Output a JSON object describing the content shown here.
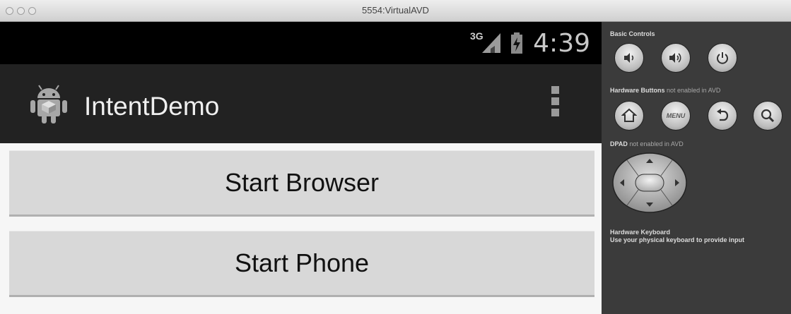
{
  "window": {
    "title": "5554:VirtualAVD"
  },
  "status_bar": {
    "network": "3G",
    "time": "4:39"
  },
  "action_bar": {
    "title": "IntentDemo",
    "icon": "android-robot-icon",
    "overflow_icon": "overflow-menu-icon"
  },
  "buttons": [
    {
      "label": "Start Browser"
    },
    {
      "label": "Start Phone"
    }
  ],
  "controls": {
    "basic_heading": "Basic Controls",
    "basic": [
      "volume-down-icon",
      "volume-up-icon",
      "power-icon"
    ],
    "hardware_heading": "Hardware Buttons",
    "hardware_note": "not enabled in AVD",
    "hardware": [
      "home-icon",
      "menu",
      "back-icon",
      "search-icon"
    ],
    "menu_label": "MENU",
    "dpad_heading": "DPAD",
    "dpad_note": "not enabled in AVD",
    "keyboard_heading": "Hardware Keyboard",
    "keyboard_text": "Use your physical keyboard to provide input"
  }
}
